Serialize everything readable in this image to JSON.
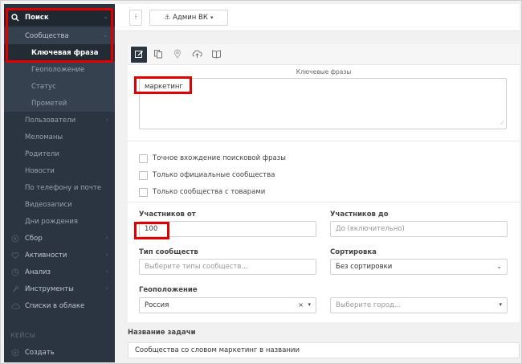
{
  "sidebar": {
    "items": [
      {
        "label": "Поиск",
        "icon": "search-icon"
      },
      {
        "label": "Сообщества"
      },
      {
        "label": "Ключевая фраза"
      },
      {
        "label": "Геоположение"
      },
      {
        "label": "Статус"
      },
      {
        "label": "Прометей"
      },
      {
        "label": "Пользователи"
      },
      {
        "label": "Меломаны"
      },
      {
        "label": "Родители"
      },
      {
        "label": "Новости"
      },
      {
        "label": "По телефону и почте"
      },
      {
        "label": "Видеозаписи"
      },
      {
        "label": "Дни рождения"
      },
      {
        "label": "Сбор",
        "icon": "target-icon"
      },
      {
        "label": "Активности",
        "icon": "heart-icon"
      },
      {
        "label": "Анализ",
        "icon": "chart-icon"
      },
      {
        "label": "Инструменты",
        "icon": "wrench-icon"
      },
      {
        "label": "Списки в облаке",
        "icon": "cloud-icon"
      },
      {
        "label": "КЕЙСЫ"
      },
      {
        "label": "Создать",
        "icon": "plus-circle-icon"
      }
    ]
  },
  "topbar": {
    "more_label": "⁝",
    "admin_label": "Админ ВК"
  },
  "tabs": [
    {
      "name": "edit",
      "icon": "edit-icon",
      "active": true
    },
    {
      "name": "copy",
      "icon": "copy-icon"
    },
    {
      "name": "location",
      "icon": "map-pin-icon"
    },
    {
      "name": "upload",
      "icon": "cloud-upload-icon"
    },
    {
      "name": "book",
      "icon": "book-icon"
    }
  ],
  "form": {
    "keywords_label": "Ключевые фразы",
    "keywords_value": "маркетинг",
    "checkboxes": [
      {
        "label": "Точное вхождение поисковой фразы",
        "checked": false
      },
      {
        "label": "Только официальные сообщества",
        "checked": false
      },
      {
        "label": "Только сообщества с товарами",
        "checked": false
      }
    ],
    "members_from_label": "Участников от",
    "members_from_value": "100",
    "members_to_label": "Участников до",
    "members_to_placeholder": "До (включительно)",
    "type_label": "Тип сообществ",
    "type_placeholder": "Выберите типы сообществ...",
    "sort_label": "Сортировка",
    "sort_value": "Без сортировки",
    "geo_label": "Геоположение",
    "country_value": "Россия",
    "city_placeholder": "Выберите город..."
  },
  "task": {
    "label": "Название задачи",
    "value": "Сообщества со словом маркетинг в названии"
  },
  "colors": {
    "sidebar_bg": "#2b3441",
    "highlight": "#e00000"
  }
}
